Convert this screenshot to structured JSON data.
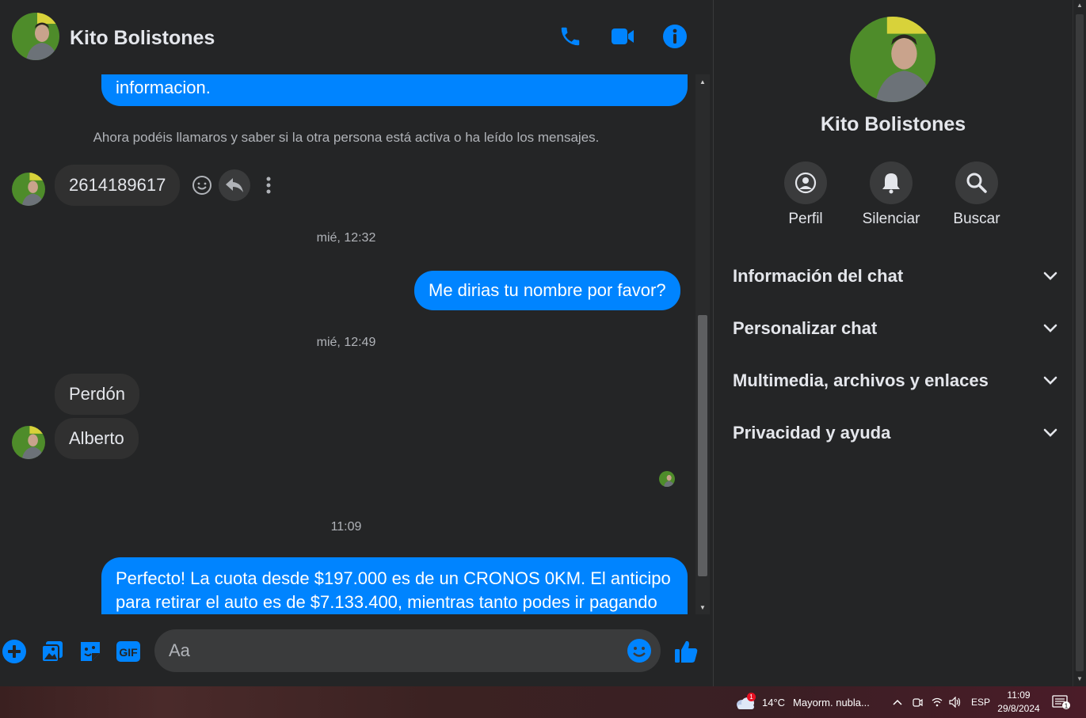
{
  "header": {
    "contact_name": "Kito Bolistones",
    "icons": [
      "phone-icon",
      "video-icon",
      "info-icon"
    ]
  },
  "messages": {
    "partial_outgoing_top": "informacion.",
    "system_note": "Ahora podéis llamaros y saber si la otra persona está activa o ha leído los mensajes.",
    "incoming_number": "2614189617",
    "time_1": "mié, 12:32",
    "outgoing_1": "Me dirias tu nombre por favor?",
    "time_2": "mié, 12:49",
    "incoming_1": "Perdón",
    "incoming_2": "Alberto",
    "time_3": "11:09",
    "outgoing_2_line1": "Perfecto! La cuota desde $197.000 es de un CRONOS 0KM. El anticipo",
    "outgoing_2_line2": "para retirar el auto es de $7.133.400, mientras tanto podes ir pagando"
  },
  "composer": {
    "placeholder": "Aa",
    "icons": [
      "plus-icon",
      "image-icon",
      "sticker-icon",
      "gif-icon",
      "emoji-icon",
      "thumbs-up-icon"
    ],
    "gif_label": "GIF"
  },
  "info_panel": {
    "name": "Kito Bolistones",
    "actions": [
      {
        "label": "Perfil",
        "icon": "profile-icon"
      },
      {
        "label": "Silenciar",
        "icon": "bell-icon"
      },
      {
        "label": "Buscar",
        "icon": "search-icon"
      }
    ],
    "sections": [
      {
        "title": "Información del chat"
      },
      {
        "title": "Personalizar chat"
      },
      {
        "title": "Multimedia, archivos y enlaces"
      },
      {
        "title": "Privacidad y ayuda"
      }
    ]
  },
  "taskbar": {
    "weather_badge": "1",
    "temperature": "14°C",
    "weather_text": "Mayorm. nubla...",
    "language": "ESP",
    "time": "11:09",
    "date": "29/8/2024",
    "notification_count": "1"
  },
  "colors": {
    "accent": "#0084ff",
    "background": "#242526",
    "incoming_bubble": "#303030",
    "text": "#e4e6eb",
    "muted_text": "#b0b3b8"
  }
}
